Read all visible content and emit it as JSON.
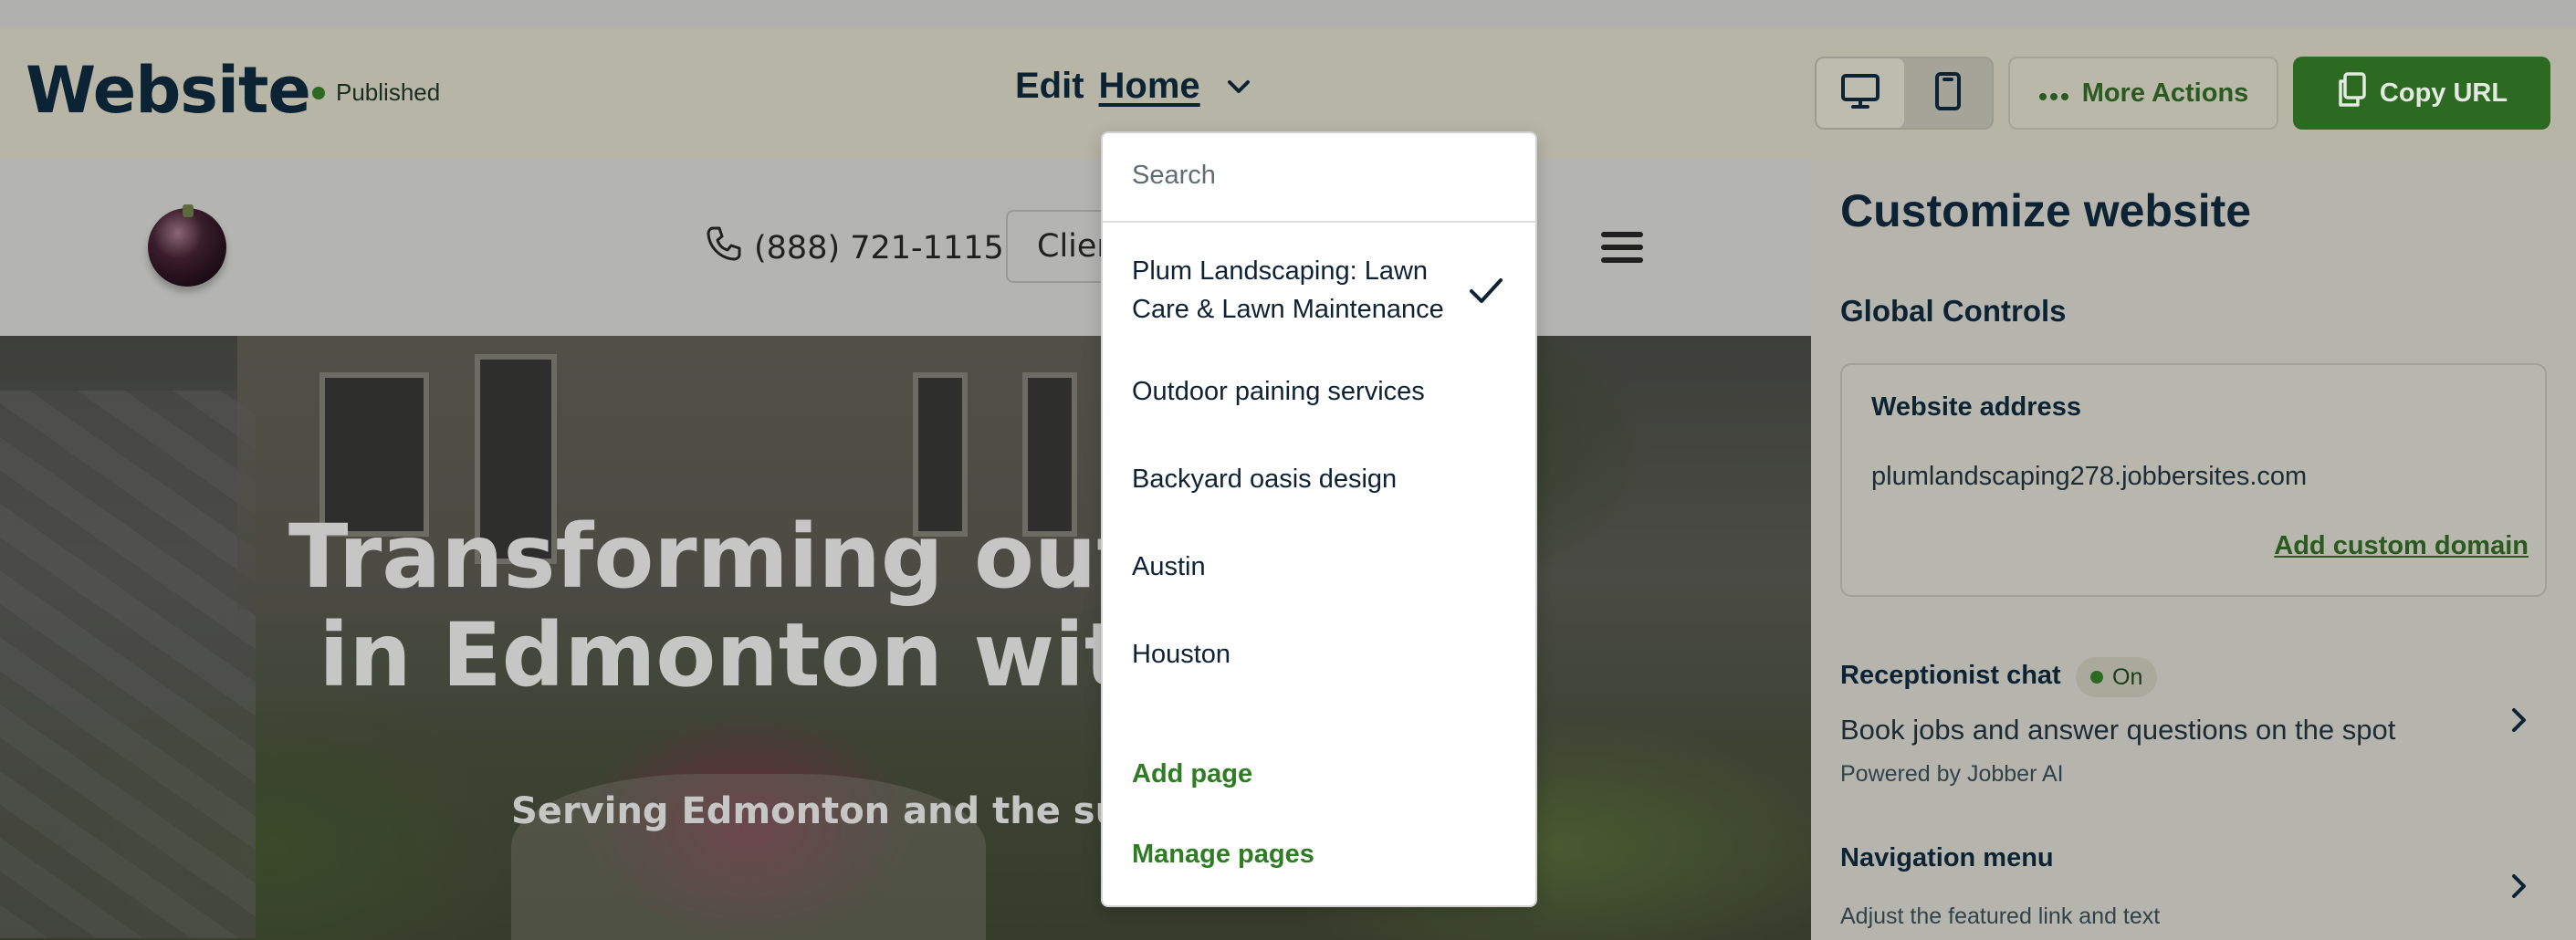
{
  "header": {
    "title": "Website",
    "status": "Published",
    "edit_label": "Edit",
    "current_page": "Home",
    "more_actions": "More Actions",
    "copy_url": "Copy URL",
    "accent_color": "#2c6a22"
  },
  "preview": {
    "phone": "(888) 721-1115",
    "client_button": "Client",
    "hero_title": "Transforming outdo\n in Edmonton with ex",
    "hero_subtitle": "Serving Edmonton and the surrou"
  },
  "dropdown": {
    "search_placeholder": "Search",
    "pages": [
      "Plum Landscaping: Lawn Care & Lawn Maintenance",
      "Outdoor paining services",
      "Backyard oasis design",
      "Austin",
      "Houston"
    ],
    "selected_index": 0,
    "add_page": "Add page",
    "manage_pages": "Manage pages"
  },
  "panel": {
    "title": "Customize website",
    "global_controls": "Global Controls",
    "website_address_label": "Website address",
    "website_address": "plumlandscaping278.jobbersites.com",
    "add_custom_domain": "Add custom domain",
    "receptionist": {
      "title": "Receptionist chat",
      "badge": "On",
      "description": "Book jobs and answer questions on the spot",
      "powered_by": "Powered by Jobber AI"
    },
    "navigation": {
      "title": "Navigation menu",
      "description": "Adjust the featured link and text"
    }
  }
}
